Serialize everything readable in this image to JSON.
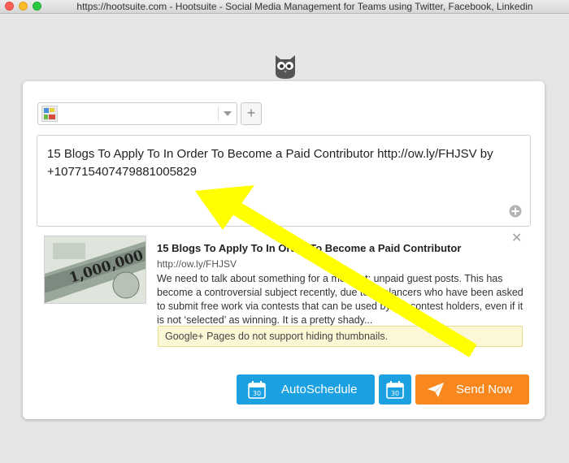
{
  "window": {
    "title": "https://hootsuite.com - Hootsuite - Social Media Management for Teams using Twitter, Facebook, Linkedin"
  },
  "composer": {
    "add_profile_label": "+",
    "message": "15 Blogs To Apply To In Order To Become a Paid Contributor http://ow.ly/FHJSV by +107715407479881005829"
  },
  "preview": {
    "title": "15 Blogs To Apply To In Order To Become a Paid Contributor",
    "url": "http://ow.ly/FHJSV",
    "description": "We need to talk about something for a moment: unpaid guest posts. This has become a controversial subject recently, due to freelancers who have been asked to submit free work via contests that can be used by the contest holders, even if it is not ‘selected’ as winning. It is a pretty shady...",
    "close_label": "✕",
    "thumbnail_note": "1,000,000",
    "notice": "Google+ Pages do not support hiding thumbnails."
  },
  "actions": {
    "autoschedule_label": "AutoSchedule",
    "calendar_day": "30",
    "send_label": "Send Now"
  },
  "colors": {
    "primary_blue": "#1ba1e2",
    "send_orange": "#f8881e",
    "notice_bg": "#fcf8d6",
    "annotation_arrow": "#ffff00"
  }
}
